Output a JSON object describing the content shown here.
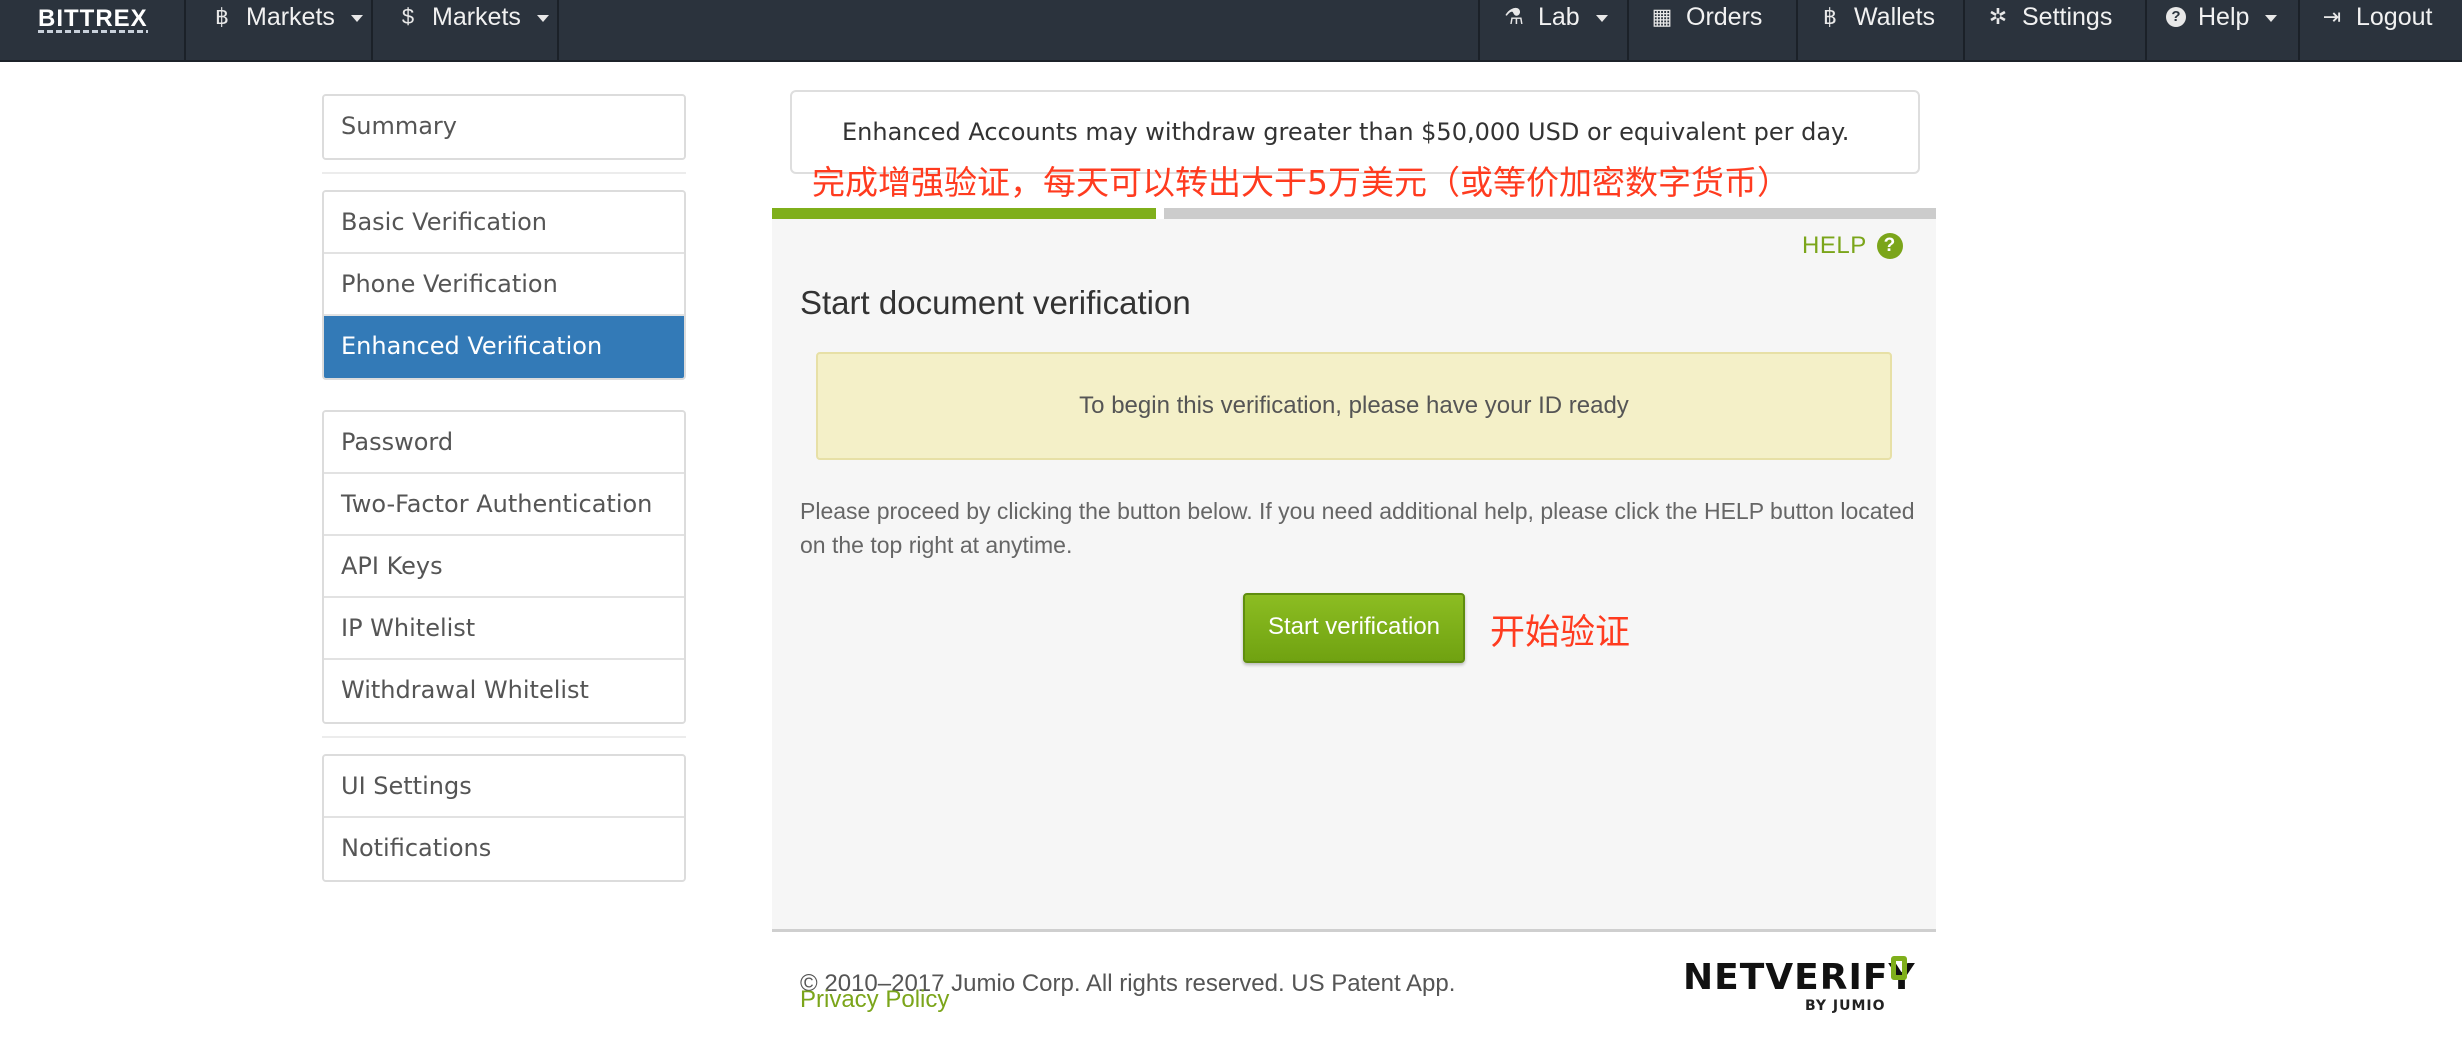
{
  "navbar": {
    "brand": "BITTREX",
    "left_items": [
      {
        "icon": "bitcoin-icon",
        "glyph": "฿",
        "label": "Markets"
      },
      {
        "icon": "dollar-icon",
        "glyph": "$",
        "label": "Markets"
      }
    ],
    "right_items": [
      {
        "icon": "flask-icon",
        "glyph": "⚗",
        "label": "Lab"
      },
      {
        "icon": "calendar-icon",
        "glyph": "▦",
        "label": "Orders"
      },
      {
        "icon": "bitcoin-icon",
        "glyph": "฿",
        "label": "Wallets"
      },
      {
        "icon": "gear-icon",
        "glyph": "✲",
        "label": "Settings"
      },
      {
        "icon": "question-circle-icon",
        "glyph": "?",
        "label": "Help"
      },
      {
        "icon": "logout-icon",
        "glyph": "⇥",
        "label": "Logout"
      }
    ]
  },
  "sidebar": {
    "groups": [
      [
        "Summary"
      ],
      [
        "Basic Verification",
        "Phone Verification",
        "Enhanced Verification"
      ],
      [
        "Password",
        "Two-Factor Authentication",
        "API Keys",
        "IP Whitelist",
        "Withdrawal Whitelist"
      ],
      [
        "UI Settings",
        "Notifications"
      ]
    ],
    "active": "Enhanced Verification"
  },
  "notice": {
    "text": "Enhanced Accounts may withdraw greater than $50,000 USD or equivalent per day.",
    "annotation_cn": "完成增强验证，每天可以转出大于5万美元（或等价加密数字货币）"
  },
  "verification": {
    "progress_fraction": 0.33,
    "help_label": "HELP",
    "help_icon": "?",
    "title": "Start document verification",
    "id_notice": "To begin this verification, please have your ID ready",
    "instructions": "Please proceed by clicking the button below. If you need additional help, please click the HELP button located on the top right at anytime.",
    "start_button": "Start verification",
    "start_annotation_cn": "开始验证"
  },
  "footer": {
    "copyright": "© 2010–2017 Jumio Corp. All rights reserved. US Patent App.",
    "privacy": "Privacy Policy",
    "logo_text": "NETVERIFY",
    "logo_sub": "BY JUMIO"
  },
  "colors": {
    "navbar_bg": "#2b333d",
    "active_blue": "#337ab7",
    "jumio_green": "#7faf1b",
    "annotation_red": "#ff3b1f",
    "id_box_bg": "#f4f0c8"
  }
}
